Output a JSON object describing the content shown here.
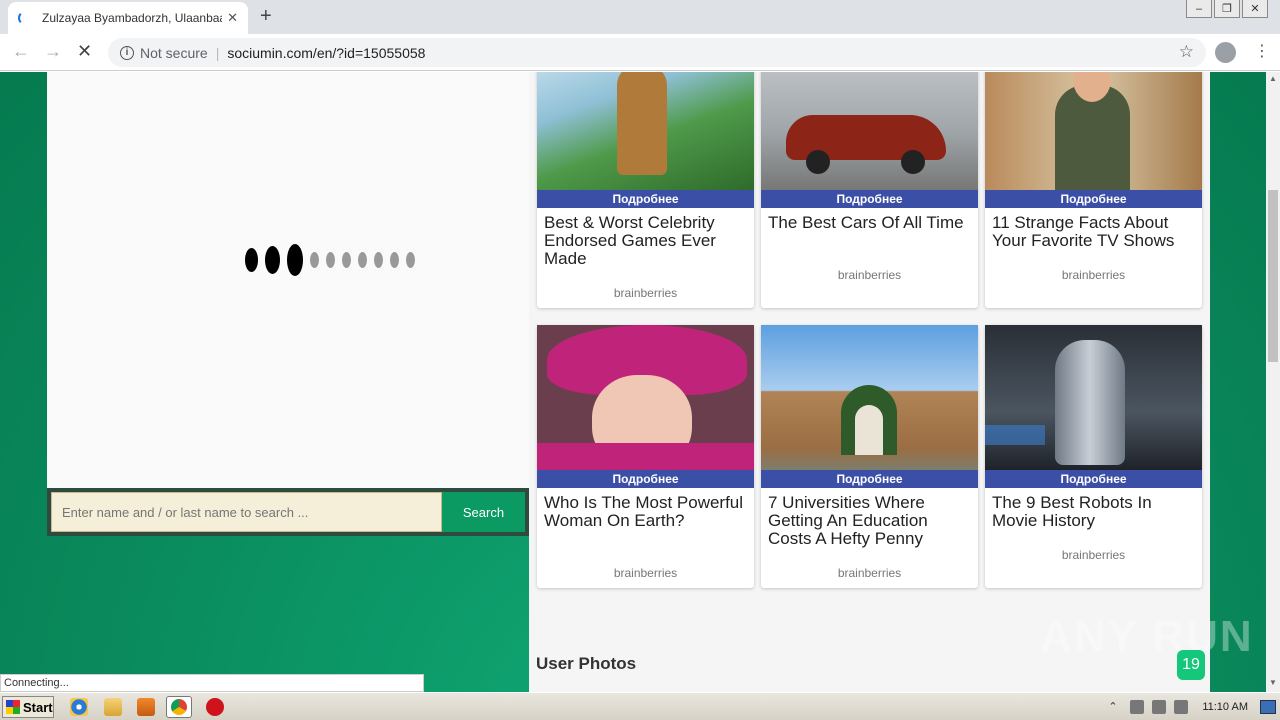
{
  "browser": {
    "tab_title": "Zulzayaa Byambadorzh, Ulaanbaatar",
    "not_secure": "Not secure",
    "url": "sociumin.com/en/?id=15055058",
    "status_text": "Connecting..."
  },
  "search": {
    "placeholder": "Enter name and / or last name to search ...",
    "button_label": "Search"
  },
  "cards": [
    {
      "title": "Best & Worst Celebrity Endorsed Games Ever Made",
      "more": "Подробнее",
      "source": "brainberries"
    },
    {
      "title": "The Best Cars Of All Time",
      "more": "Подробнее",
      "source": "brainberries"
    },
    {
      "title": "11 Strange Facts About Your Favorite TV Shows",
      "more": "Подробнее",
      "source": "brainberries"
    },
    {
      "title": "Who Is The Most Powerful Woman On Earth?",
      "more": "Подробнее",
      "source": "brainberries"
    },
    {
      "title": "7 Universities Where Getting An Education Costs A Hefty Penny",
      "more": "Подробнее",
      "source": "brainberries"
    },
    {
      "title": "The 9 Best Robots In Movie History",
      "more": "Подробнее",
      "source": "brainberries"
    }
  ],
  "section": {
    "user_photos": "User Photos"
  },
  "badge": "19",
  "watermark": "ANY RUN",
  "taskbar": {
    "start": "Start",
    "clock": "11:10 AM"
  },
  "colors": {
    "page_bg": "#0a8c5e",
    "more_band": "#3c4fa7",
    "search_button": "#0a9a62"
  }
}
